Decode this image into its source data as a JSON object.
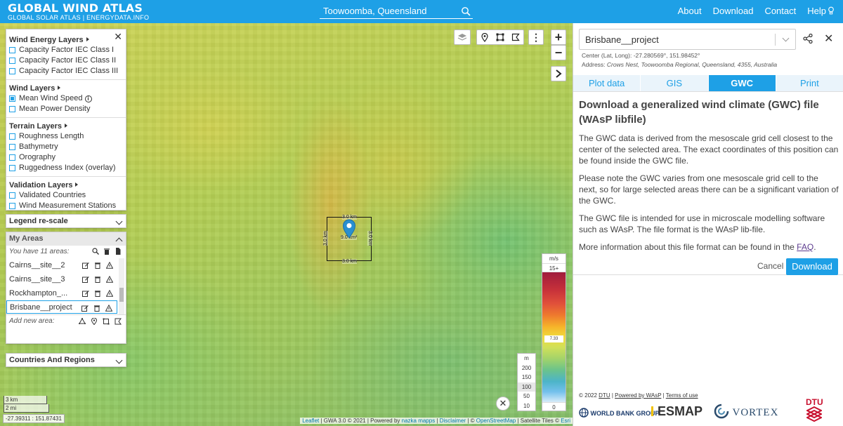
{
  "header": {
    "title": "GLOBAL WIND ATLAS",
    "subtitle": "GLOBAL SOLAR ATLAS | ENERGYDATA.INFO",
    "search_value": "Toowoomba, Queensland",
    "nav": [
      "About",
      "Download",
      "Contact",
      "Help"
    ],
    "brand_color": "#1ea0e6"
  },
  "layers_panel": {
    "groups": [
      {
        "title": "Wind Energy Layers",
        "items": [
          {
            "label": "Capacity Factor IEC Class I",
            "checked": false
          },
          {
            "label": "Capacity Factor IEC Class II",
            "checked": false
          },
          {
            "label": "Capacity Factor IEC Class III",
            "checked": false
          }
        ]
      },
      {
        "title": "Wind Layers",
        "items": [
          {
            "label": "Mean Wind Speed",
            "checked": true
          },
          {
            "label": "Mean Power Density",
            "checked": false
          }
        ]
      },
      {
        "title": "Terrain Layers",
        "items": [
          {
            "label": "Roughness Length",
            "checked": false
          },
          {
            "label": "Bathymetry",
            "checked": false
          },
          {
            "label": "Orography",
            "checked": false
          },
          {
            "label": "Ruggedness Index (overlay)",
            "checked": false
          }
        ]
      },
      {
        "title": "Validation Layers",
        "items": [
          {
            "label": "Validated Countries",
            "checked": false
          },
          {
            "label": "Wind Measurement Stations",
            "checked": false
          }
        ]
      }
    ]
  },
  "legend_rescale": "Legend re-scale",
  "my_areas": {
    "title": "My Areas",
    "count_text": "You have 11 areas:",
    "areas": [
      "Cairns__site__2",
      "Cairns__site__3",
      "Rockhampton_...",
      "Brisbane__project"
    ],
    "selected": "Brisbane__project",
    "add_label": "Add new area:"
  },
  "countries": "Countries And Regions",
  "map": {
    "selection_dims": {
      "top": "3.0 km",
      "bottom": "3.0 km",
      "left": "3.0 km",
      "right": "3.0 km",
      "area": "9.0 km²"
    },
    "wind_legend": {
      "unit": "m/s",
      "top": "15+",
      "mark": "7.33",
      "bottom": "0"
    },
    "elevation": {
      "unit": "m",
      "values": [
        "200",
        "150",
        "100",
        "50",
        "10"
      ]
    },
    "scale_km": "3 km",
    "scale_mi": "2 mi",
    "coords": "-27.39311 : 151.87431",
    "attribution_parts": [
      "Leaflet",
      " | GWA 3.0 © 2021 | Powered by ",
      "nazka mapps",
      " | ",
      "Disclaimer",
      " | © ",
      "OpenStreetMap",
      " | Satellite Tiles © ",
      "Esri"
    ]
  },
  "right_panel": {
    "project": "Brisbane__project",
    "center": "Center (Lat, Long): -27.280569°, 151.98452°",
    "address_label": "Address:",
    "address_value": "Crows Nest, Toowoomba Regional, Queensland, 4355, Australia",
    "tabs": [
      "Plot data",
      "GIS",
      "GWC",
      "Print"
    ],
    "active_tab": "GWC",
    "heading": "Download a generalized wind climate (GWC) file (WAsP libfile)",
    "para1": "The GWC data is derived from the mesoscale grid cell closest to the center of the selected area. The exact coordinates of this position can be found inside the GWC file.",
    "para2": "Please note the GWC varies from one mesoscale grid cell to the next, so for large selected areas there can be a significant variation of the GWC.",
    "para3": "The GWC file is intended for use in microscale modelling software such as WAsP. The file format is the WAsP lib-file.",
    "para4_pre": "More information about this file format can be found in the ",
    "para4_link": "FAQ",
    "para4_post": ".",
    "cancel": "Cancel",
    "download": "Download",
    "footer": {
      "copy": "© 2022",
      "dtu": "DTU",
      "wasp": "Powered by WAsP",
      "terms": "Terms of use"
    },
    "logos": [
      "WORLD BANK GROUP",
      "ESMAP",
      "VORTEX",
      "DTU"
    ]
  }
}
